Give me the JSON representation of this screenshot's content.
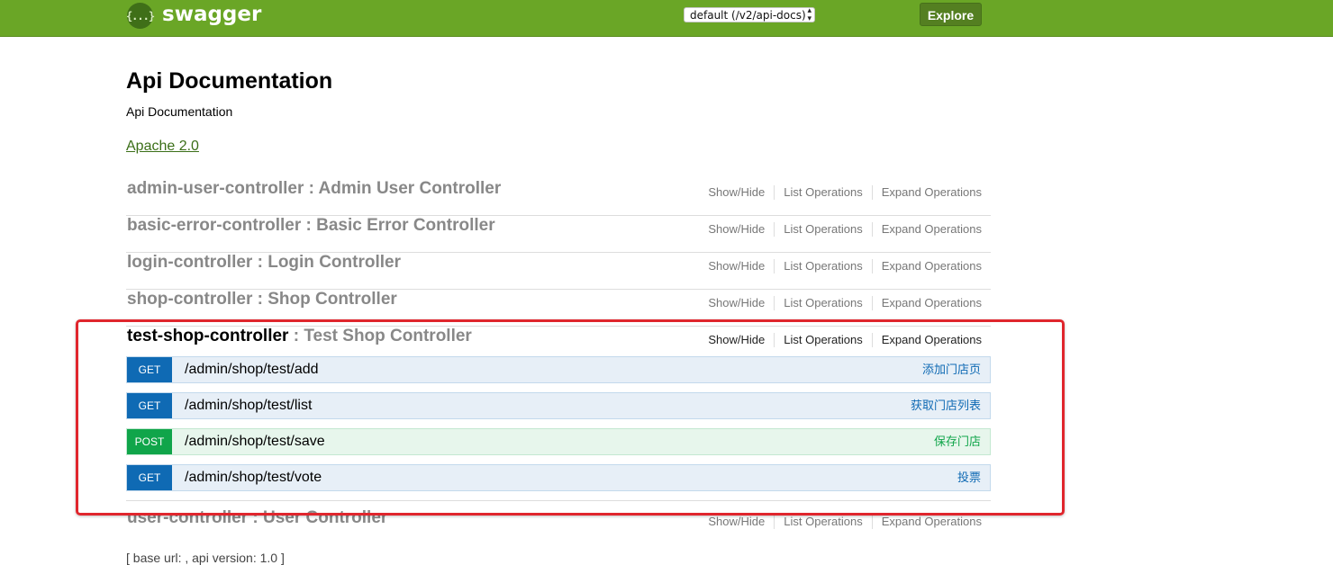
{
  "header": {
    "logo_glyph": "{...}",
    "brand": "swagger",
    "spec_select": "default (/v2/api-docs)",
    "explore_label": "Explore",
    "bar_color": "#6aa626"
  },
  "info": {
    "title": "Api Documentation",
    "description": "Api Documentation",
    "license": "Apache 2.0"
  },
  "resource_actions": {
    "show_hide": "Show/Hide",
    "list_operations": "List Operations",
    "expand_operations": "Expand Operations"
  },
  "resources": [
    {
      "name": "admin-user-controller",
      "description": " : Admin User Controller"
    },
    {
      "name": "basic-error-controller",
      "description": " : Basic Error Controller"
    },
    {
      "name": "login-controller",
      "description": " : Login Controller"
    },
    {
      "name": "shop-controller",
      "description": " : Shop Controller"
    },
    {
      "name": "test-shop-controller",
      "description": " : Test Shop Controller"
    },
    {
      "name": "user-controller",
      "description": " : User Controller"
    }
  ],
  "operations": [
    {
      "method": "GET",
      "path": "/admin/shop/test/add",
      "summary": "添加门店页"
    },
    {
      "method": "GET",
      "path": "/admin/shop/test/list",
      "summary": "获取门店列表"
    },
    {
      "method": "POST",
      "path": "/admin/shop/test/save",
      "summary": "保存门店"
    },
    {
      "method": "GET",
      "path": "/admin/shop/test/vote",
      "summary": "投票"
    }
  ],
  "footer": "[ base url: , api version: 1.0 ]",
  "colors": {
    "get": "#0f6ab4",
    "post": "#10a54a",
    "highlight": "#e0262d"
  }
}
